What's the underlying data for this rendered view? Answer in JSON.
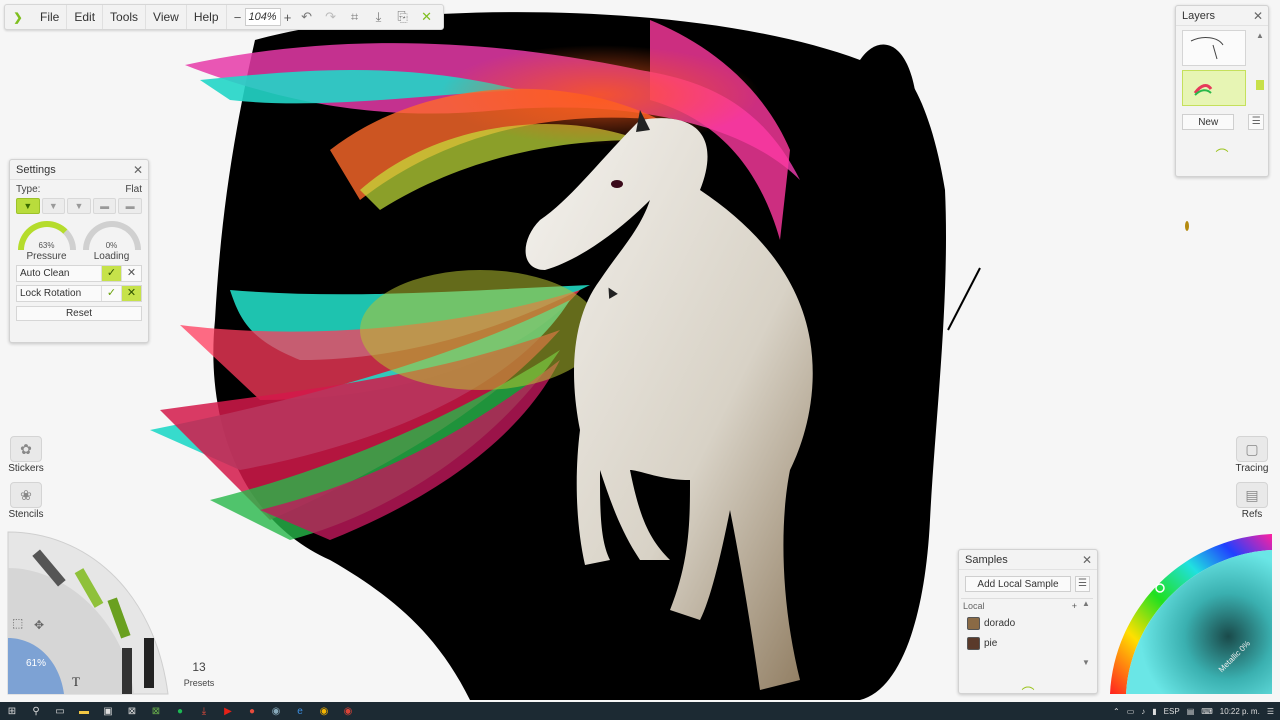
{
  "menubar": {
    "items": [
      "File",
      "Edit",
      "Tools",
      "View",
      "Help"
    ],
    "zoom_minus": "−",
    "zoom_value": "104%",
    "zoom_plus": "+"
  },
  "settings": {
    "title": "Settings",
    "type_label": "Type:",
    "type_value": "Flat",
    "pressure_value": "63%",
    "pressure_label": "Pressure",
    "loading_value": "0%",
    "loading_label": "Loading",
    "auto_clean_label": "Auto Clean",
    "lock_rotation_label": "Lock Rotation",
    "reset_label": "Reset"
  },
  "layers": {
    "title": "Layers",
    "new_label": "New"
  },
  "samples": {
    "title": "Samples",
    "add_label": "Add Local Sample",
    "list_header": "Local",
    "items": [
      {
        "name": "dorado",
        "color": "#8a6a45"
      },
      {
        "name": "pie",
        "color": "#5a3a2a"
      }
    ]
  },
  "side_left": {
    "stickers_label": "Stickers",
    "stencils_label": "Stencils"
  },
  "side_right": {
    "tracing_label": "Tracing",
    "refs_label": "Refs"
  },
  "toolwheel": {
    "size_value": "61%",
    "text_tool": "T"
  },
  "presets": {
    "count": "13",
    "label": "Presets"
  },
  "colorwheel": {
    "metallic_label": "Metallic 0%"
  },
  "taskbar": {
    "lang": "ESP",
    "time": "10:22 p. m."
  },
  "colors": {
    "accent": "#b5dc2c",
    "canvas_bg": "#f6f6f6",
    "taskbar": "#1c2a33"
  }
}
